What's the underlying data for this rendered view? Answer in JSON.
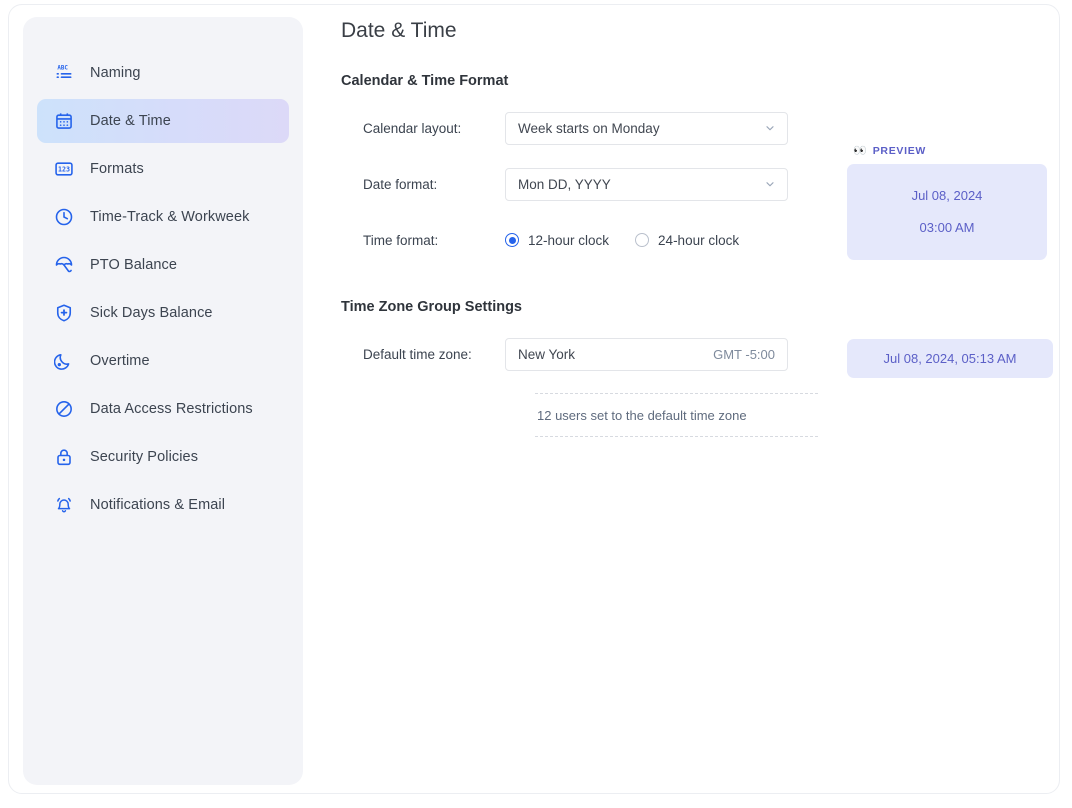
{
  "sidebar": {
    "items": [
      {
        "label": "Naming",
        "icon": "abc-list-icon",
        "active": false
      },
      {
        "label": "Date & Time",
        "icon": "calendar-icon",
        "active": true
      },
      {
        "label": "Formats",
        "icon": "numbers-123-icon",
        "active": false
      },
      {
        "label": "Time-Track & Workweek",
        "icon": "clock-icon",
        "active": false
      },
      {
        "label": "PTO Balance",
        "icon": "umbrella-icon",
        "active": false
      },
      {
        "label": "Sick Days Balance",
        "icon": "shield-plus-icon",
        "active": false
      },
      {
        "label": "Overtime",
        "icon": "moon-icon",
        "active": false
      },
      {
        "label": "Data Access Restrictions",
        "icon": "no-entry-icon",
        "active": false
      },
      {
        "label": "Security Policies",
        "icon": "lock-icon",
        "active": false
      },
      {
        "label": "Notifications & Email",
        "icon": "bell-ringing-icon",
        "active": false
      }
    ]
  },
  "main": {
    "page_title": "Date & Time",
    "sections": {
      "calendar": {
        "title": "Calendar & Time Format",
        "calendar_layout": {
          "label": "Calendar layout:",
          "value": "Week starts on Monday"
        },
        "date_format": {
          "label": "Date format:",
          "value": "Mon DD, YYYY"
        },
        "time_format": {
          "label": "Time format:",
          "options": [
            {
              "label": "12-hour clock",
              "selected": true
            },
            {
              "label": "24-hour clock",
              "selected": false
            }
          ]
        }
      },
      "timezone": {
        "title": "Time Zone Group Settings",
        "default_time_zone": {
          "label": "Default time zone:",
          "value": "New York",
          "offset": "GMT -5:00"
        },
        "note": "12 users set to the default time zone"
      }
    }
  },
  "previews": {
    "format_preview": {
      "eyes_icon": "👀",
      "label": "PREVIEW",
      "date": "Jul 08, 2024",
      "time": "03:00 AM"
    },
    "timezone_preview": {
      "value": "Jul 08, 2024, 05:13 AM"
    }
  },
  "colors": {
    "accent": "#2563eb",
    "preview_bg": "#e5e8fb",
    "preview_text": "#5b5fc7",
    "sidebar_bg": "#f3f4f8"
  }
}
